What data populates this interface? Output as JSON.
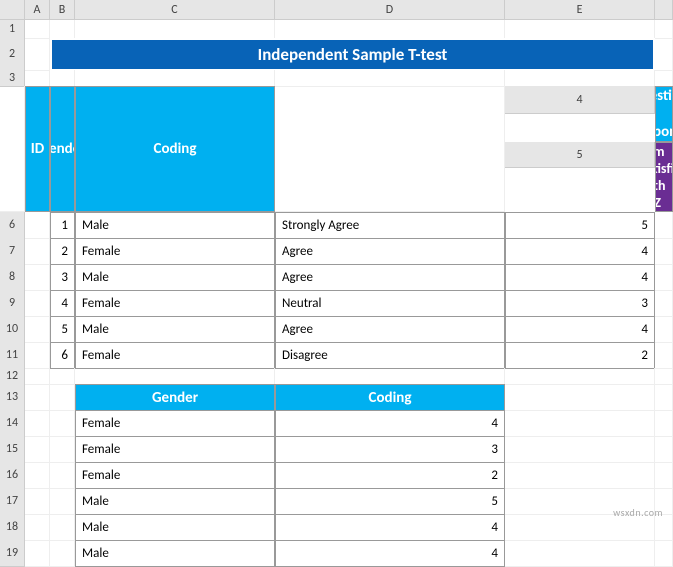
{
  "columns": {
    "A": "A",
    "B": "B",
    "C": "C",
    "D": "D",
    "E": "E"
  },
  "row_labels": [
    "1",
    "2",
    "3",
    "4",
    "5",
    "6",
    "7",
    "8",
    "9",
    "10",
    "11",
    "12",
    "13",
    "14",
    "15",
    "16",
    "17",
    "18",
    "19"
  ],
  "title": "Independent Sample T-test",
  "table1": {
    "headers": {
      "id": "ID",
      "gender": "Gender",
      "qr": "Questions & Responses",
      "sub": "I am Satisfied with XYZ",
      "coding": "Coding"
    },
    "rows": [
      {
        "id": "1",
        "gender": "Male",
        "resp": "Strongly Agree",
        "coding": "5"
      },
      {
        "id": "2",
        "gender": "Female",
        "resp": "Agree",
        "coding": "4"
      },
      {
        "id": "3",
        "gender": "Male",
        "resp": "Agree",
        "coding": "4"
      },
      {
        "id": "4",
        "gender": "Female",
        "resp": "Neutral",
        "coding": "3"
      },
      {
        "id": "5",
        "gender": "Male",
        "resp": "Agree",
        "coding": "4"
      },
      {
        "id": "6",
        "gender": "Female",
        "resp": "Disagree",
        "coding": "2"
      }
    ]
  },
  "table2": {
    "headers": {
      "gender": "Gender",
      "coding": "Coding"
    },
    "rows": [
      {
        "gender": "Female",
        "coding": "4"
      },
      {
        "gender": "Female",
        "coding": "3"
      },
      {
        "gender": "Female",
        "coding": "2"
      },
      {
        "gender": "Male",
        "coding": "5"
      },
      {
        "gender": "Male",
        "coding": "4"
      },
      {
        "gender": "Male",
        "coding": "4"
      }
    ]
  },
  "watermark": "wsxdn.com"
}
